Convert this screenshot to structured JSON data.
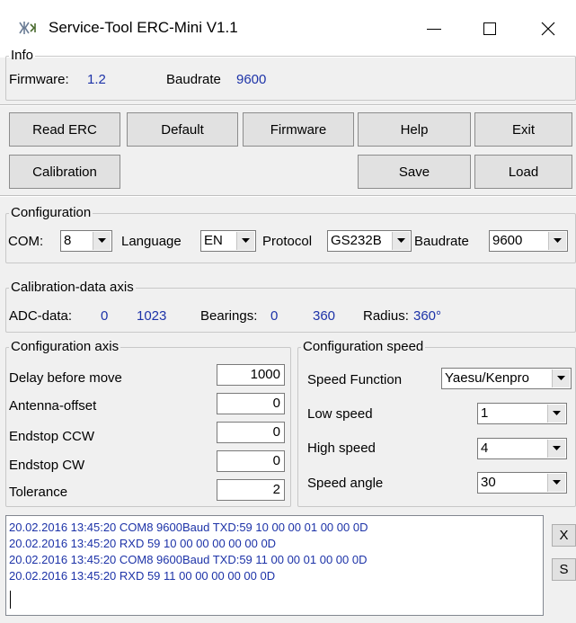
{
  "window": {
    "title": "Service-Tool ERC-Mini V1.1",
    "icon": "antenna-rotor-icon"
  },
  "info": {
    "legend": "Info",
    "firmware_label": "Firmware:",
    "firmware_value": "1.2",
    "baudrate_label": "Baudrate",
    "baudrate_value": "9600"
  },
  "toolbar": {
    "read_erc": "Read ERC",
    "default": "Default",
    "firmware": "Firmware",
    "help": "Help",
    "exit": "Exit",
    "calibration": "Calibration",
    "save": "Save",
    "load": "Load"
  },
  "configuration": {
    "legend": "Configuration",
    "com_label": "COM:",
    "com_value": "8",
    "language_label": "Language",
    "language_value": "EN",
    "protocol_label": "Protocol",
    "protocol_value": "GS232B",
    "baudrate_label": "Baudrate",
    "baudrate_value": "9600"
  },
  "calibration_axis": {
    "legend": "Calibration-data axis",
    "adc_label": "ADC-data:",
    "adc_min": "0",
    "adc_max": "1023",
    "bearings_label": "Bearings:",
    "bearings_min": "0",
    "bearings_max": "360",
    "radius_label": "Radius:",
    "radius_value": "360°"
  },
  "config_axis": {
    "legend": "Configuration axis",
    "delay_label": "Delay before move",
    "delay_value": "1000",
    "antenna_offset_label": "Antenna-offset",
    "antenna_offset_value": "0",
    "endstop_ccw_label": "Endstop CCW",
    "endstop_ccw_value": "0",
    "endstop_cw_label": "Endstop CW",
    "endstop_cw_value": "0",
    "tolerance_label": "Tolerance",
    "tolerance_value": "2"
  },
  "config_speed": {
    "legend": "Configuration speed",
    "speed_function_label": "Speed Function",
    "speed_function_value": "Yaesu/Kenpro",
    "low_speed_label": "Low speed",
    "low_speed_value": "1",
    "high_speed_label": "High speed",
    "high_speed_value": "4",
    "speed_angle_label": "Speed angle",
    "speed_angle_value": "30"
  },
  "log": {
    "lines": [
      "20.02.2016 13:45:20 COM8 9600Baud TXD:59 10 00 00 01 00 00 0D",
      "20.02.2016 13:45:20 RXD 59 10 00 00 00 00 00 0D",
      "20.02.2016 13:45:20 COM8 9600Baud TXD:59 11 00 00 01 00 00 0D",
      "20.02.2016 13:45:20 RXD 59 11 00 00 00 00 00 0D"
    ],
    "side_buttons": [
      "X",
      "S"
    ]
  },
  "colors": {
    "value_text": "#1d33a8",
    "window_bg": "#f0f0f0",
    "button_bg": "#e1e1e1"
  }
}
